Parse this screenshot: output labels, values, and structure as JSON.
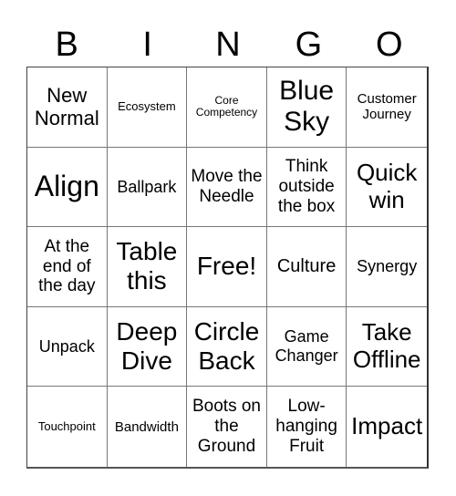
{
  "header": [
    "B",
    "I",
    "N",
    "G",
    "O"
  ],
  "cells": [
    {
      "text": "New Normal",
      "size": "s22"
    },
    {
      "text": "Ecosystem",
      "size": "s13"
    },
    {
      "text": "Core Competency",
      "size": "s12"
    },
    {
      "text": "Blue Sky",
      "size": "s30"
    },
    {
      "text": "Customer Journey",
      "size": "s15"
    },
    {
      "text": "Align",
      "size": "s32"
    },
    {
      "text": "Ballpark",
      "size": "s18"
    },
    {
      "text": "Move the Needle",
      "size": "s19"
    },
    {
      "text": "Think outside the box",
      "size": "s19"
    },
    {
      "text": "Quick win",
      "size": "s26"
    },
    {
      "text": "At the end of the day",
      "size": "s19"
    },
    {
      "text": "Table this",
      "size": "s28"
    },
    {
      "text": "Free!",
      "size": "s28"
    },
    {
      "text": "Culture",
      "size": "s20"
    },
    {
      "text": "Synergy",
      "size": "s18"
    },
    {
      "text": "Unpack",
      "size": "s18"
    },
    {
      "text": "Deep Dive",
      "size": "s28"
    },
    {
      "text": "Circle Back",
      "size": "s28"
    },
    {
      "text": "Game Changer",
      "size": "s18"
    },
    {
      "text": "Take Offline",
      "size": "s26"
    },
    {
      "text": "Touchpoint",
      "size": "s13"
    },
    {
      "text": "Bandwidth",
      "size": "s15"
    },
    {
      "text": "Boots on the Ground",
      "size": "s19"
    },
    {
      "text": "Low-hanging Fruit",
      "size": "s19"
    },
    {
      "text": "Impact",
      "size": "s26"
    }
  ]
}
